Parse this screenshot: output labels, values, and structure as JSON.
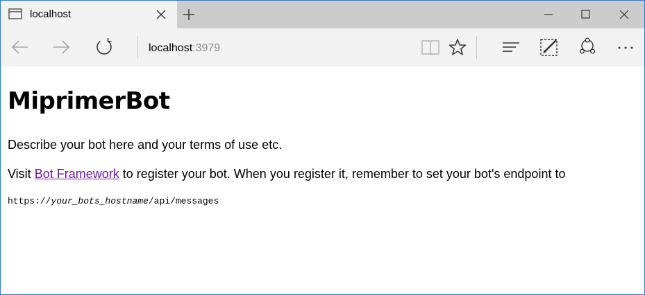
{
  "tab": {
    "title": "localhost"
  },
  "address_bar": {
    "host": "localhost",
    "port": ":3979"
  },
  "page": {
    "title": "MiprimerBot",
    "description": "Describe your bot here and your terms of use etc.",
    "visit_prefix": "Visit ",
    "visit_link": "Bot Framework",
    "visit_suffix": " to register your bot. When you register it, remember to set your bot's endpoint to",
    "endpoint_prefix": "https://",
    "endpoint_host": "your_bots_hostname",
    "endpoint_path": "/api/messages"
  },
  "icons": {
    "tab": "tab-icon",
    "close_tab": "close-icon",
    "new_tab": "plus-icon",
    "minimize": "minimize-icon",
    "maximize": "maximize-icon",
    "close_window": "close-icon",
    "back": "back-arrow-icon",
    "forward": "forward-arrow-icon",
    "refresh": "refresh-icon",
    "reading_view": "book-icon",
    "favorites": "star-icon",
    "hub": "hub-icon",
    "web_note": "pen-icon",
    "share": "share-icon",
    "more": "ellipsis-icon"
  },
  "colors": {
    "titlebar": "#cccccc",
    "active_tab": "#f2f2f2",
    "link_visited": "#6a1b9a",
    "window_border": "#2b7bd3",
    "port_text": "#8c8c8c"
  }
}
